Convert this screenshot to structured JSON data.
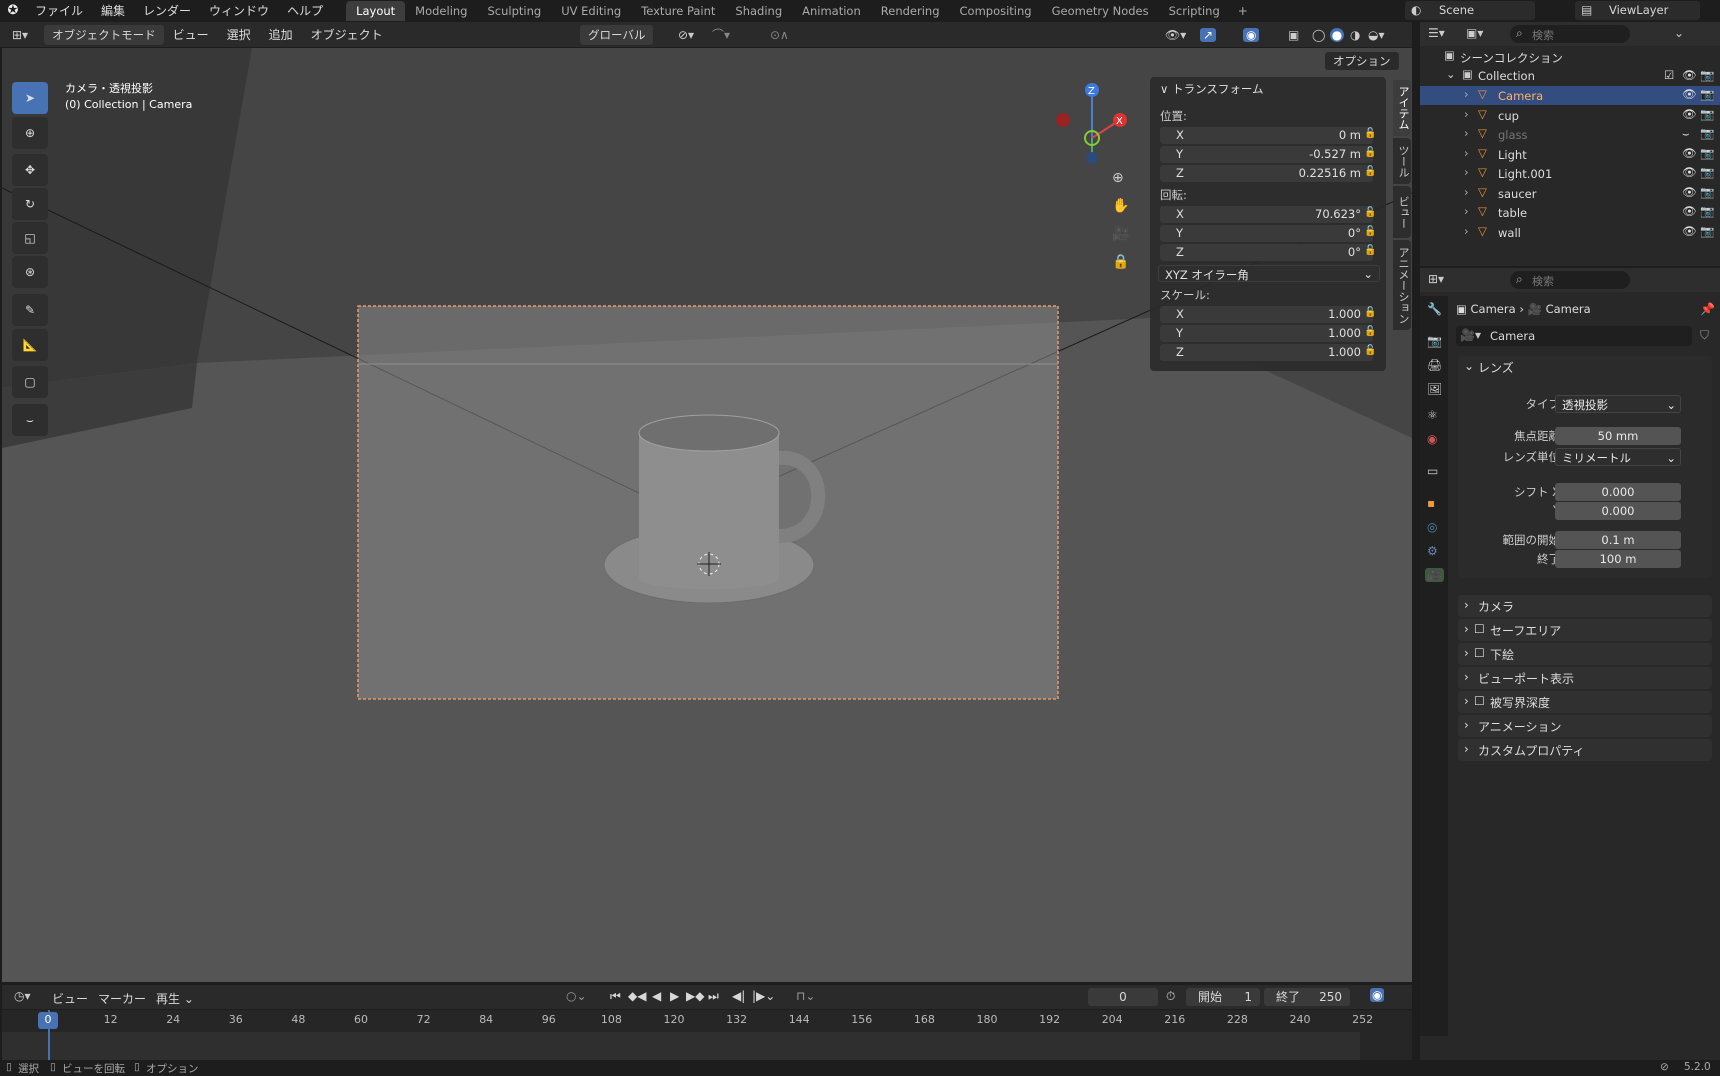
{
  "menu": [
    "ファイル",
    "編集",
    "レンダー",
    "ウィンドウ",
    "ヘルプ"
  ],
  "workspaces": [
    "Layout",
    "Modeling",
    "Sculpting",
    "UV Editing",
    "Texture Paint",
    "Shading",
    "Animation",
    "Rendering",
    "Compositing",
    "Geometry Nodes",
    "Scripting"
  ],
  "scene": "Scene",
  "view_layer": "ViewLayer",
  "vp": {
    "mode": "オブジェクトモード",
    "view": "ビュー",
    "select": "選択",
    "add": "追加",
    "object": "オブジェクト",
    "orient": "グローバル",
    "options": "オプション",
    "overlay_title": "カメラ・透視投影",
    "overlay_sub": "(0) Collection | Camera"
  },
  "npanel": {
    "title": "トランスフォーム",
    "loc_label": "位置:",
    "loc": [
      "0 m",
      "-0.527 m",
      "0.22516 m"
    ],
    "rot_label": "回転:",
    "rot": [
      "70.623°",
      "0°",
      "0°"
    ],
    "rot_mode": "XYZ オイラー角",
    "scale_label": "スケール:",
    "scale": [
      "1.000",
      "1.000",
      "1.000"
    ],
    "axes": [
      "X",
      "Y",
      "Z"
    ],
    "tabs": [
      "アイテム",
      "ツール",
      "ビュー",
      "アニメーション"
    ]
  },
  "outliner": {
    "search_placeholder": "検索",
    "scene_collection": "シーンコレクション",
    "collection": "Collection",
    "items": [
      {
        "name": "Camera",
        "sel": true
      },
      {
        "name": "cup"
      },
      {
        "name": "glass",
        "dim": true
      },
      {
        "name": "Light"
      },
      {
        "name": "Light.001"
      },
      {
        "name": "saucer"
      },
      {
        "name": "table"
      },
      {
        "name": "wall"
      }
    ]
  },
  "props": {
    "search_placeholder": "検索",
    "bc1": "Camera",
    "bc2": "Camera",
    "datablock": "Camera",
    "lens": "レンズ",
    "type_label": "タイプ",
    "type": "透視投影",
    "focal_label": "焦点距離",
    "focal": "50 mm",
    "unit_label": "レンズ単位",
    "unit": "ミリメートル",
    "shiftx_label": "シフト X",
    "shiftx": "0.000",
    "shifty_label": "Y",
    "shifty": "0.000",
    "clipstart_label": "範囲の開始",
    "clipstart": "0.1 m",
    "clipend_label": "終了",
    "clipend": "100 m",
    "sections": [
      "カメラ",
      "セーフエリア",
      "下絵",
      "ビューポート表示",
      "被写界深度",
      "アニメーション",
      "カスタムプロパティ"
    ]
  },
  "timeline": {
    "view": "ビュー",
    "marker": "マーカー",
    "play": "再生",
    "frame": "0",
    "start_label": "開始",
    "start": "1",
    "end_label": "終了",
    "end": "250",
    "ticks": [
      "0",
      "12",
      "24",
      "36",
      "48",
      "60",
      "72",
      "84",
      "96",
      "108",
      "120",
      "132",
      "144",
      "156",
      "168",
      "180",
      "192",
      "204",
      "216",
      "228",
      "240",
      "252"
    ]
  },
  "status": {
    "select": "選択",
    "rotate": "ビューを回転",
    "options": "オプション",
    "version": "5.2.0"
  }
}
